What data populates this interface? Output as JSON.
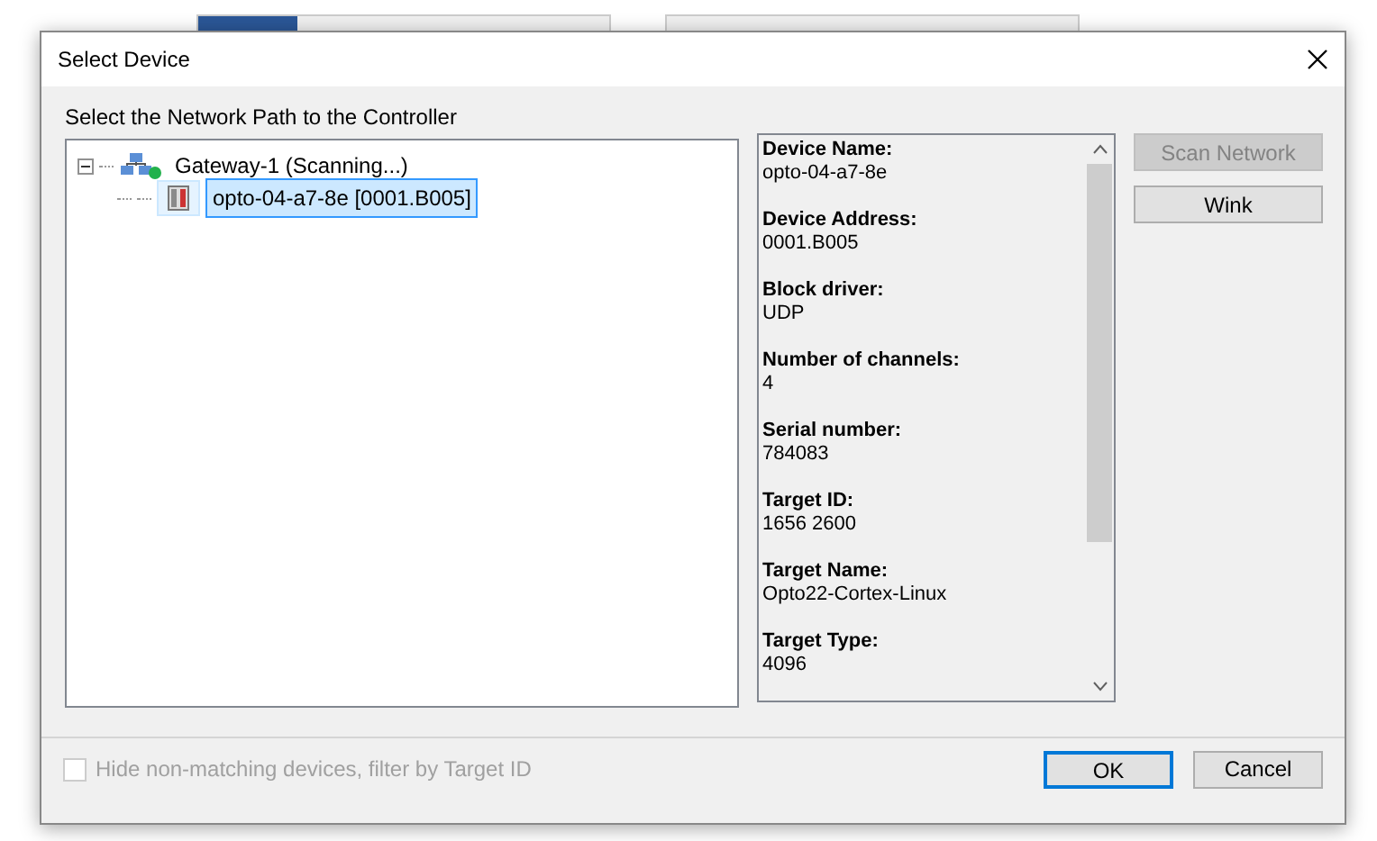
{
  "window": {
    "title": "Select Device"
  },
  "tree_label": "Select the Network Path to the Controller",
  "tree": [
    {
      "label": "Gateway-1 (Scanning...)",
      "kind": "gateway",
      "expanded": true,
      "selected": false,
      "children": [
        {
          "label": "opto-04-a7-8e [0001.B005]",
          "kind": "device",
          "selected": true
        }
      ]
    }
  ],
  "details": [
    {
      "label": "Device Name:",
      "value": "opto-04-a7-8e"
    },
    {
      "label": "Device Address:",
      "value": "0001.B005"
    },
    {
      "label": "Block driver:",
      "value": "UDP"
    },
    {
      "label": "Number of channels:",
      "value": "4"
    },
    {
      "label": "Serial number:",
      "value": "784083"
    },
    {
      "label": "Target ID:",
      "value": "1656 2600"
    },
    {
      "label": "Target Name:",
      "value": "Opto22-Cortex-Linux"
    },
    {
      "label": "Target Type:",
      "value": "4096"
    }
  ],
  "side_buttons": [
    {
      "label": "Scan Network",
      "disabled": true
    },
    {
      "label": "Wink",
      "disabled": false
    }
  ],
  "filter": {
    "label": "Hide non-matching devices, filter by Target ID",
    "checked": false,
    "disabled": true
  },
  "buttons": [
    {
      "label": "OK",
      "default": true
    },
    {
      "label": "Cancel",
      "default": false
    }
  ]
}
